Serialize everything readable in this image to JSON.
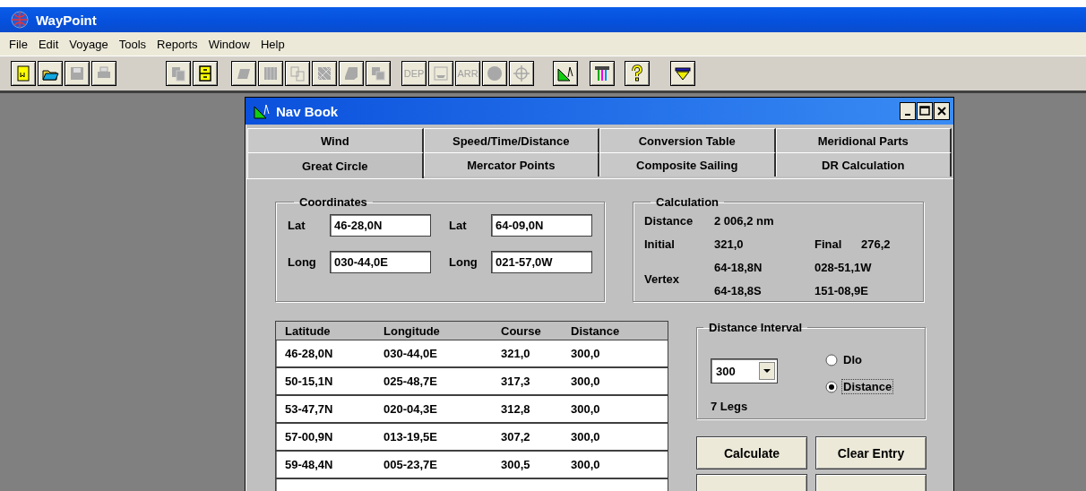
{
  "app": {
    "title": "WayPoint"
  },
  "menu": [
    "File",
    "Edit",
    "Voyage",
    "Tools",
    "Reports",
    "Window",
    "Help"
  ],
  "toolbar": {
    "groups": [
      [
        {
          "disabled": false
        },
        {
          "disabled": false
        },
        {
          "disabled": true
        },
        {
          "disabled": true
        }
      ],
      [
        {
          "disabled": true
        },
        {
          "disabled": false
        }
      ],
      [
        {
          "disabled": true
        },
        {
          "disabled": true
        },
        {
          "disabled": true
        },
        {
          "disabled": true
        },
        {
          "disabled": true
        },
        {
          "disabled": true
        }
      ],
      [
        {
          "label": "DEP",
          "disabled": true
        },
        {
          "disabled": true
        },
        {
          "label": "ARR",
          "disabled": true
        },
        {
          "disabled": true
        },
        {
          "disabled": true
        }
      ],
      [
        {
          "disabled": false
        }
      ],
      [
        {
          "disabled": false
        }
      ],
      [
        {
          "disabled": false
        }
      ],
      [
        {
          "disabled": false
        }
      ]
    ]
  },
  "nav_book": {
    "title": "Nav Book",
    "tab_rows": [
      [
        {
          "label": "Wind",
          "selected": false
        },
        {
          "label": "Speed/Time/Distance",
          "selected": false
        },
        {
          "label": "Conversion Table",
          "selected": false
        },
        {
          "label": "Meridional Parts",
          "selected": false
        }
      ],
      [
        {
          "label": "Great Circle",
          "selected": true
        },
        {
          "label": "Mercator Points",
          "selected": false
        },
        {
          "label": "Composite Sailing",
          "selected": false
        },
        {
          "label": "DR Calculation",
          "selected": false
        }
      ]
    ],
    "coordinates": {
      "title": "Coordinates",
      "fields": [
        {
          "label": "Lat",
          "value": "46-28,0N"
        },
        {
          "label": "Lat",
          "value": "64-09,0N"
        },
        {
          "label": "Long",
          "value": "030-44,0E"
        },
        {
          "label": "Long",
          "value": "021-57,0W"
        }
      ]
    },
    "calculation": {
      "title": "Calculation",
      "distance_label": "Distance",
      "distance": "2 006,2 nm",
      "initial_label": "Initial",
      "initial": "321,0",
      "final_label": "Final",
      "final": "276,2",
      "vertex_label": "Vertex",
      "vertex": [
        [
          "64-18,8N",
          "028-51,1W"
        ],
        [
          "64-18,8S",
          "151-08,9E"
        ]
      ]
    },
    "table": {
      "columns": [
        "Latitude",
        "Longitude",
        "Course",
        "Distance"
      ],
      "rows": [
        [
          "46-28,0N",
          "030-44,0E",
          "321,0",
          "300,0"
        ],
        [
          "50-15,1N",
          "025-48,7E",
          "317,3",
          "300,0"
        ],
        [
          "53-47,7N",
          "020-04,3E",
          "312,8",
          "300,0"
        ],
        [
          "57-00,9N",
          "013-19,5E",
          "307,2",
          "300,0"
        ],
        [
          "59-48,4N",
          "005-23,7E",
          "300,5",
          "300,0"
        ]
      ]
    },
    "distance_interval": {
      "title": "Distance Interval",
      "value": "300",
      "legs": "7 Legs",
      "options": [
        {
          "label": "Dlo",
          "selected": false,
          "focused": false
        },
        {
          "label": "Distance",
          "selected": true,
          "focused": true
        }
      ]
    },
    "buttons": [
      {
        "kind": "full",
        "label": "Calculate"
      },
      {
        "kind": "full",
        "label": "Clear Entry"
      },
      {
        "kind": "cut"
      },
      {
        "kind": "cut"
      }
    ]
  }
}
